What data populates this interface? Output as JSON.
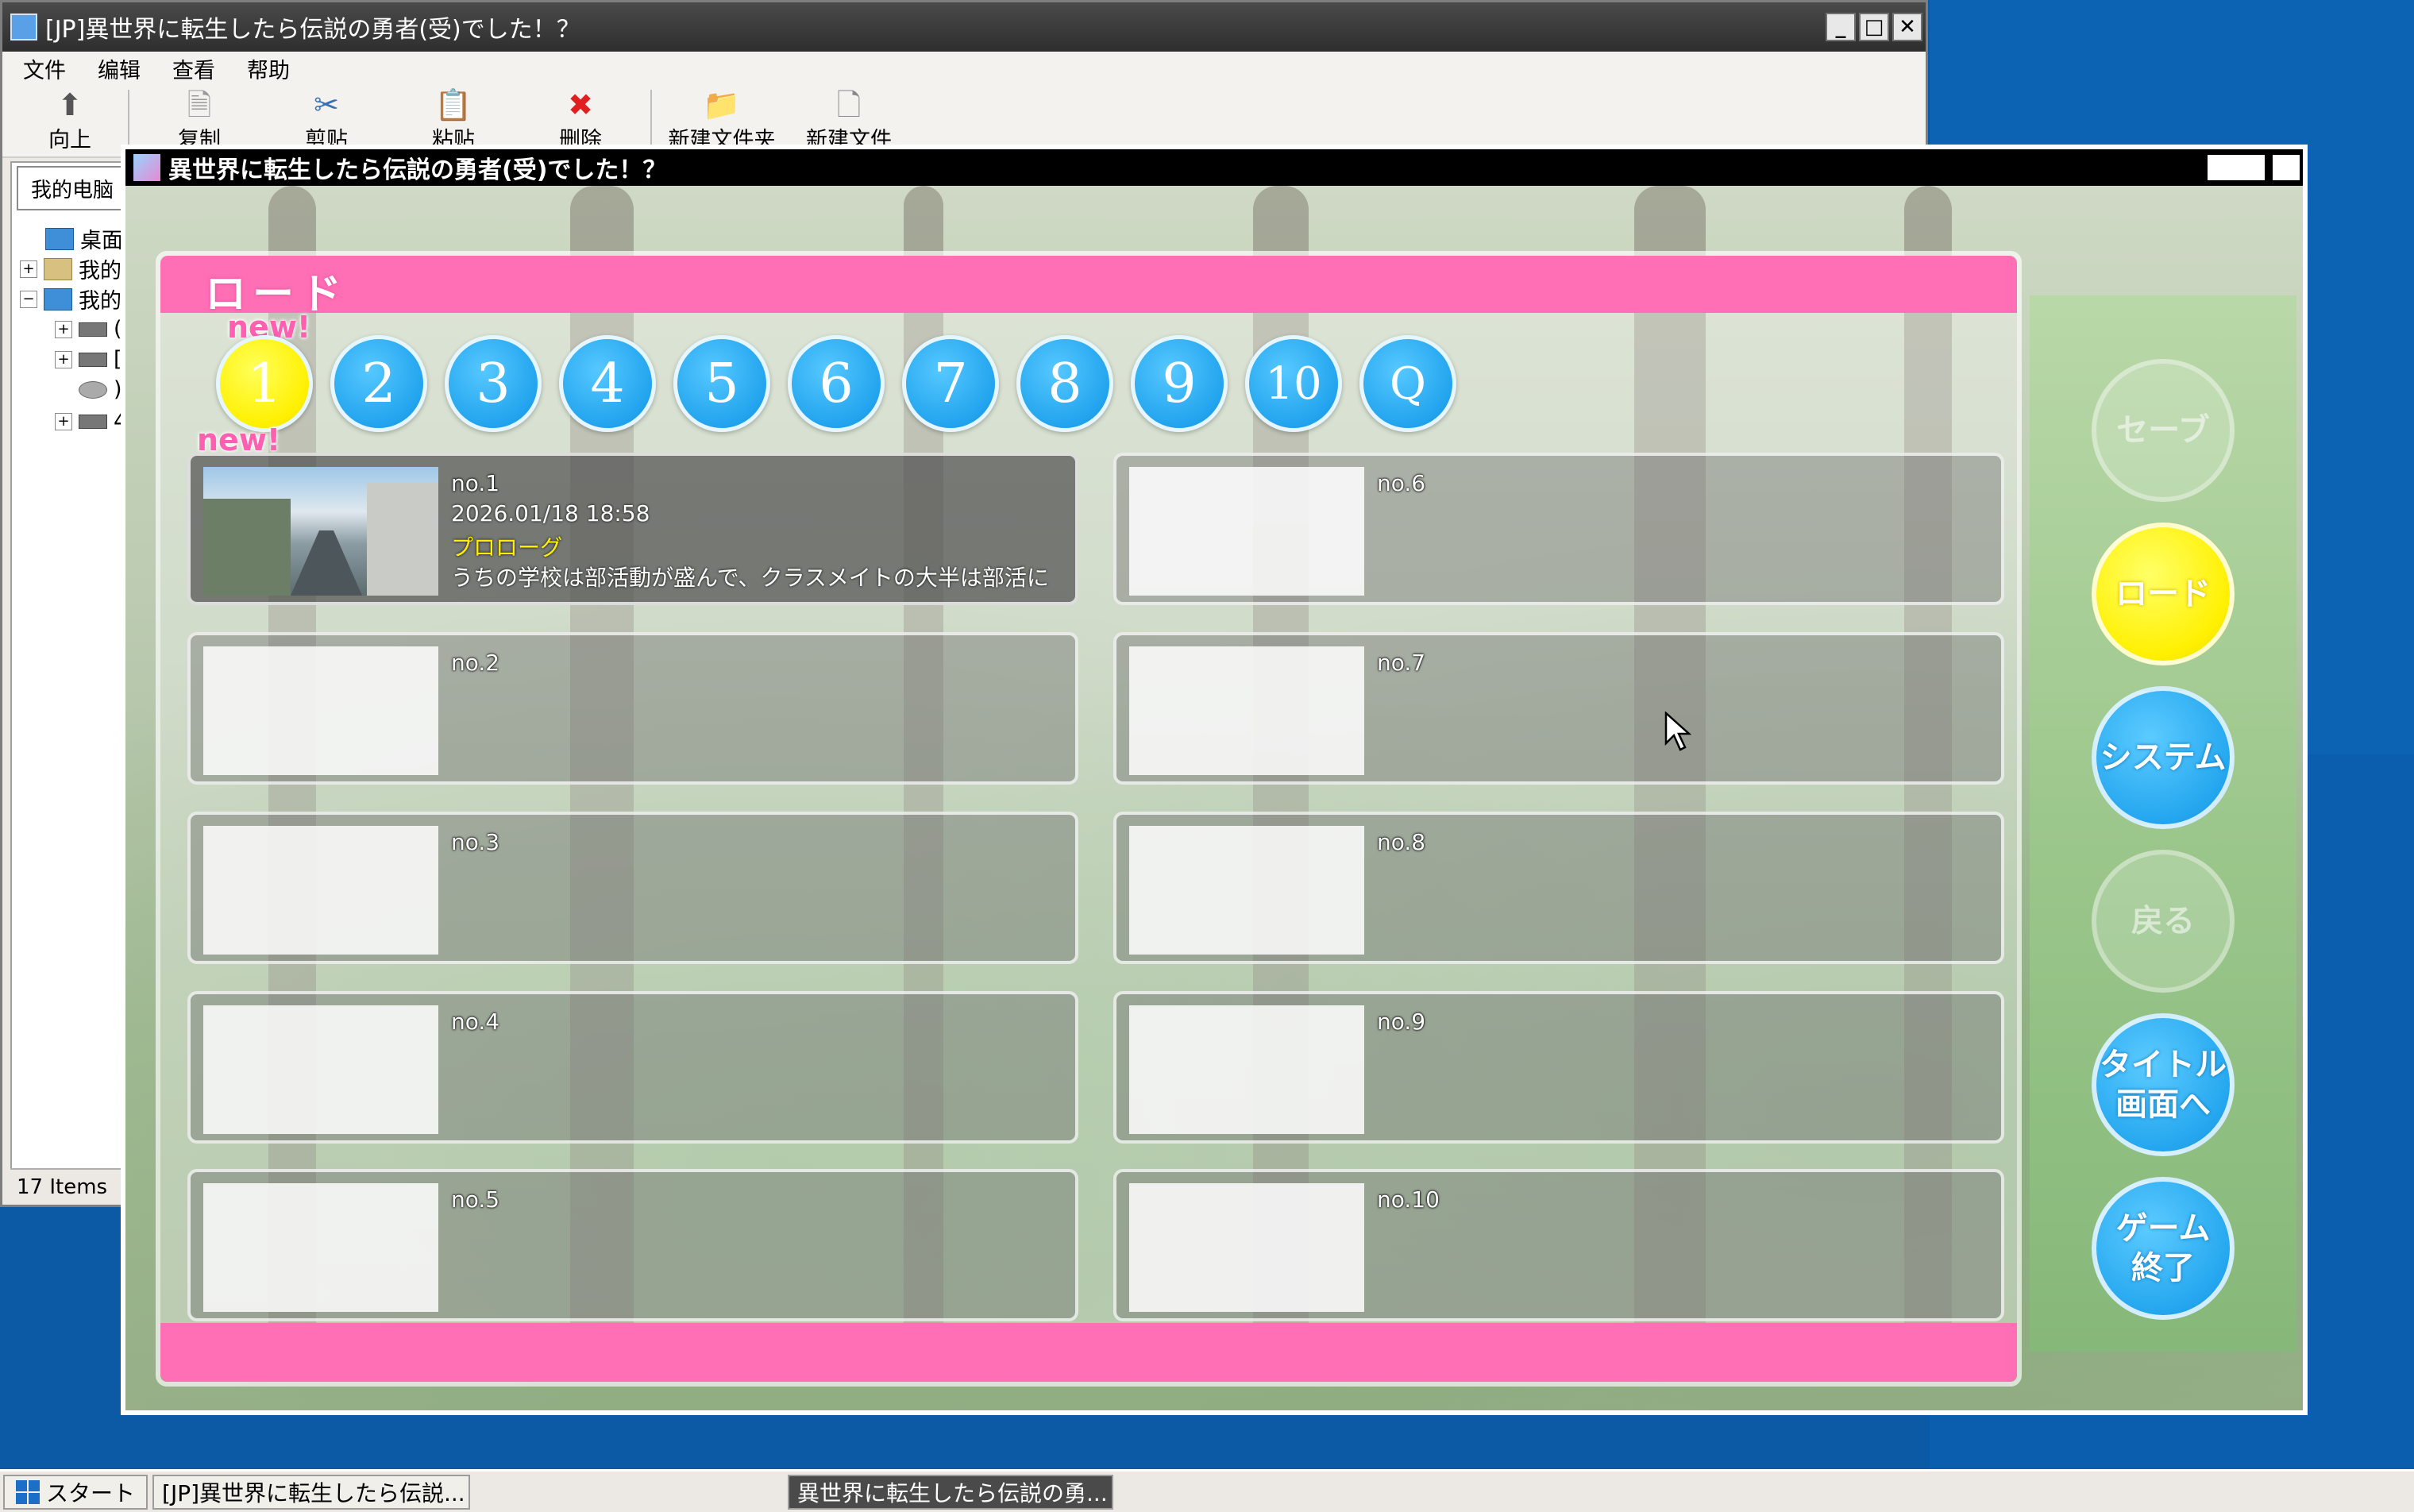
{
  "explorer": {
    "title": "[JP]異世界に転生したら伝説の勇者(受)でした！？",
    "menu": [
      "文件",
      "编辑",
      "查看",
      "帮助"
    ],
    "toolbar": {
      "up": "向上",
      "copy": "复制",
      "cut": "剪贴",
      "paste": "粘贴",
      "delete": "删除",
      "new_folder": "新建文件夹",
      "new_file": "新建文件"
    },
    "address": "我的电脑",
    "tree": [
      {
        "label": "桌面",
        "toggle": ""
      },
      {
        "label": "我的",
        "toggle": "+"
      },
      {
        "label": "我的",
        "toggle": "−"
      },
      {
        "label": "(",
        "toggle": "+"
      },
      {
        "label": "[",
        "toggle": "+"
      },
      {
        "label": ")",
        "toggle": ""
      },
      {
        "label": "4",
        "toggle": "+"
      }
    ],
    "status": "17 Items"
  },
  "game": {
    "title": "異世界に転生したら伝説の勇者(受)でした！？",
    "screen_title": "ロード",
    "new_label": "new!",
    "pages": [
      "1",
      "2",
      "3",
      "4",
      "5",
      "6",
      "7",
      "8",
      "9",
      "10",
      "Q"
    ],
    "active_page": "1",
    "slots": [
      {
        "no": "no.1",
        "date": "2026.01/18 18:58",
        "chapter": "プロローグ",
        "text": "うちの学校は部活動が盛んで、クラスメイトの大半は部活に"
      },
      {
        "no": "no.2"
      },
      {
        "no": "no.3"
      },
      {
        "no": "no.4"
      },
      {
        "no": "no.5"
      },
      {
        "no": "no.6"
      },
      {
        "no": "no.7"
      },
      {
        "no": "no.8"
      },
      {
        "no": "no.9"
      },
      {
        "no": "no.10"
      }
    ],
    "side_buttons": {
      "save": "セーブ",
      "load": "ロード",
      "system": "システム",
      "back": "戻る",
      "title_l1": "タイトル",
      "title_l2": "画面へ",
      "quit_l1": "ゲーム",
      "quit_l2": "終了"
    }
  },
  "taskbar": {
    "start": "スタート",
    "task1": "[JP]異世界に転生したら伝説...",
    "task2": "異世界に転生したら伝説の勇..."
  },
  "colors": {
    "pink": "#ff6fb5",
    "blue_button": "#22a4ee",
    "yellow_button": "#fff000",
    "desktop": "#0c5aa6"
  }
}
